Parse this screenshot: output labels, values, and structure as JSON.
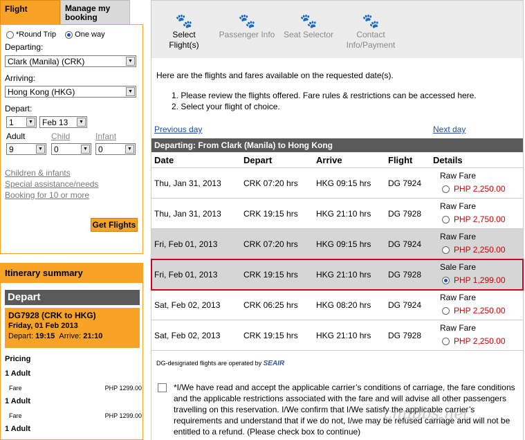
{
  "tabs": {
    "flight": "Flight",
    "manage": "Manage my booking"
  },
  "trip": {
    "round": "*Round Trip",
    "oneway": "One way"
  },
  "form": {
    "departing_label": "Departing:",
    "departing_value": "Clark (Manila) (CRK)",
    "arriving_label": "Arriving:",
    "arriving_value": "Hong Kong (HKG)",
    "depart_label": "Depart:",
    "day": "1",
    "month": "Feb 13",
    "adult_label": "Adult",
    "child_label": "Child",
    "infant_label": "Infant",
    "adult_value": "9",
    "child_value": "0",
    "infant_value": "0",
    "link_children": "Children & infants",
    "link_special": "Special assistance/needs",
    "link_booking10": "Booking for 10 or more",
    "get_flights": "Get Flights"
  },
  "itinerary": {
    "title": "Itinerary summary",
    "depart_header": "Depart",
    "flight": "DG7928  (CRK to HKG)",
    "date": "Friday, 01 Feb 2013",
    "depart_label": "Depart:",
    "depart_time": "19:15",
    "arrive_label": "Arrive:",
    "arrive_time": "21:10",
    "pricing": "Pricing",
    "adult1": "1  Adult",
    "fare_label": "Fare",
    "fare_amount": "PHP 1299.00",
    "adult2": "1  Adult",
    "fare_label2": "Fare",
    "fare_amount2": "PHP 1299.00",
    "adult3": "1  Adult"
  },
  "steps": [
    {
      "label": "Select Flight(s)"
    },
    {
      "label": "Passenger Info"
    },
    {
      "label": "Seat Selector"
    },
    {
      "label": "Contact",
      "label2": "Info/Payment"
    }
  ],
  "intro": {
    "line1": "Here are the flights and fares available on the requested date(s).",
    "item1": "1.  Please review the flights offered. Fare rules & restrictions can be accessed here.",
    "item2": "2.  Select your flight of choice."
  },
  "nav": {
    "prev": "Previous day",
    "next": "Next day"
  },
  "departing_bar": "Departing:  From Clark (Manila) to Hong Kong",
  "columns": {
    "date": "Date",
    "depart": "Depart",
    "arrive": "Arrive",
    "flight": "Flight",
    "details": "Details"
  },
  "flights": [
    {
      "date": "Thu, Jan 31, 2013",
      "depart": "CRK 07:20 hrs",
      "arrive": "HKG 09:15 hrs",
      "flight": "DG 7924",
      "fare_type": "Raw Fare",
      "price": "PHP 2,250.00"
    },
    {
      "date": "Thu, Jan 31, 2013",
      "depart": "CRK 19:15 hrs",
      "arrive": "HKG 21:10 hrs",
      "flight": "DG 7928",
      "fare_type": "Raw Fare",
      "price": "PHP 2,750.00"
    },
    {
      "date": "Fri, Feb 01, 2013",
      "depart": "CRK 07:20 hrs",
      "arrive": "HKG 09:15 hrs",
      "flight": "DG 7924",
      "fare_type": "Raw Fare",
      "price": "PHP 2,250.00"
    },
    {
      "date": "Fri, Feb 01, 2013",
      "depart": "CRK 19:15 hrs",
      "arrive": "HKG 21:10 hrs",
      "flight": "DG 7928",
      "fare_type": "Sale Fare",
      "price": "PHP 1,299.00"
    },
    {
      "date": "Sat, Feb 02, 2013",
      "depart": "CRK 06:25 hrs",
      "arrive": "HKG 08:20 hrs",
      "flight": "DG 7924",
      "fare_type": "Raw Fare",
      "price": "PHP 2,250.00"
    },
    {
      "date": "Sat, Feb 02, 2013",
      "depart": "CRK 19:15 hrs",
      "arrive": "HKG 21:10 hrs",
      "flight": "DG 7928",
      "fare_type": "Raw Fare",
      "price": "PHP 2,250.00"
    }
  ],
  "operated_note": "DG-designated flights are operated by",
  "operator_logo": "SEAIR",
  "terms": "*I/We have read and accept the applicable carrier’s conditions of carriage, the fare conditions and the applicable restrictions associated with the fare and will advise all other passengers travelling on this reservation. I/We confirm that I/We satisfy the applicable carrier’s requirements and understand that if we do not, I/we may be refused carriage and will not be entitled to a refund. (Please check box to continue)",
  "watermark": "chubbs.net",
  "colors": {
    "accent": "#f7a326",
    "dark_bar": "#5a5a5a",
    "price": "#cc0000",
    "selection_outline": "#d0021b"
  }
}
